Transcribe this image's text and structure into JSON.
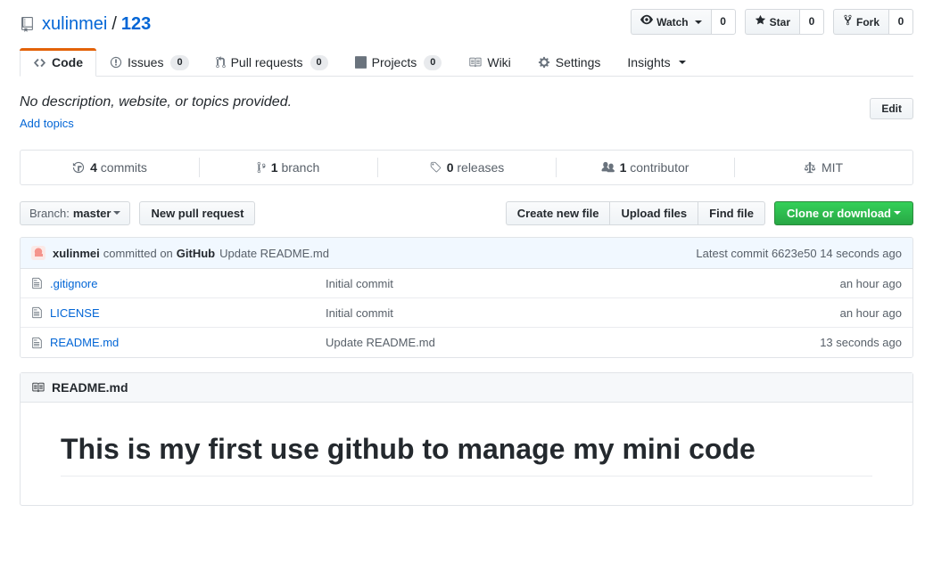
{
  "repo": {
    "icon": "repo-icon",
    "owner": "xulinmei",
    "separator": "/",
    "name": "123"
  },
  "header_actions": [
    {
      "icon": "eye-icon",
      "label": "Watch",
      "count": "0",
      "has_caret": true
    },
    {
      "icon": "star-icon",
      "label": "Star",
      "count": "0",
      "has_caret": false
    },
    {
      "icon": "fork-icon",
      "label": "Fork",
      "count": "0",
      "has_caret": false
    }
  ],
  "nav": {
    "tabs": [
      {
        "icon": "code-icon",
        "label": "Code",
        "count": null,
        "active": true,
        "caret": false
      },
      {
        "icon": "issue-opened-icon",
        "label": "Issues",
        "count": "0",
        "active": false,
        "caret": false
      },
      {
        "icon": "git-pull-request-icon",
        "label": "Pull requests",
        "count": "0",
        "active": false,
        "caret": false
      },
      {
        "icon": "project-icon",
        "label": "Projects",
        "count": "0",
        "active": false,
        "caret": false
      },
      {
        "icon": "book-icon",
        "label": "Wiki",
        "count": null,
        "active": false,
        "caret": false
      },
      {
        "icon": "gear-icon",
        "label": "Settings",
        "count": null,
        "active": false,
        "caret": false
      },
      {
        "icon": null,
        "label": "Insights",
        "count": null,
        "active": false,
        "caret": true
      }
    ]
  },
  "about": {
    "description": "No description, website, or topics provided.",
    "add_topics_label": "Add topics",
    "edit_label": "Edit"
  },
  "numbers": [
    {
      "icon": "history-icon",
      "value": "4",
      "label": "commits"
    },
    {
      "icon": "git-branch-icon",
      "value": "1",
      "label": "branch"
    },
    {
      "icon": "tag-icon",
      "value": "0",
      "label": "releases"
    },
    {
      "icon": "organization-icon",
      "value": "1",
      "label": "contributor"
    },
    {
      "icon": "law-icon",
      "value": "",
      "label": "MIT"
    }
  ],
  "filebar": {
    "branch_prefix": "Branch:",
    "branch_name": "master",
    "new_pull_request_label": "New pull request",
    "create_new_file_label": "Create new file",
    "upload_files_label": "Upload files",
    "find_file_label": "Find file",
    "clone_label": "Clone or download"
  },
  "latest_commit": {
    "avatar": "user-avatar",
    "author": "xulinmei",
    "action": "committed on",
    "platform": "GitHub",
    "message": "Update README.md",
    "latest_prefix": "Latest commit",
    "sha": "6623e50",
    "time": "14 seconds ago"
  },
  "files": [
    {
      "icon": "file-icon",
      "name": ".gitignore",
      "message": "Initial commit",
      "age": "an hour ago"
    },
    {
      "icon": "file-icon",
      "name": "LICENSE",
      "message": "Initial commit",
      "age": "an hour ago"
    },
    {
      "icon": "file-icon",
      "name": "README.md",
      "message": "Update README.md",
      "age": "13 seconds ago"
    }
  ],
  "readme": {
    "icon": "book-icon",
    "title": "README.md",
    "heading": "This is my first use github to manage my mini code"
  },
  "colors": {
    "link": "#0366d6",
    "accent_orange": "#e36209",
    "green_button": "#28a745",
    "commit_bar_bg": "#f1f8ff",
    "border": "#e1e4e8",
    "muted_text": "#586069"
  }
}
